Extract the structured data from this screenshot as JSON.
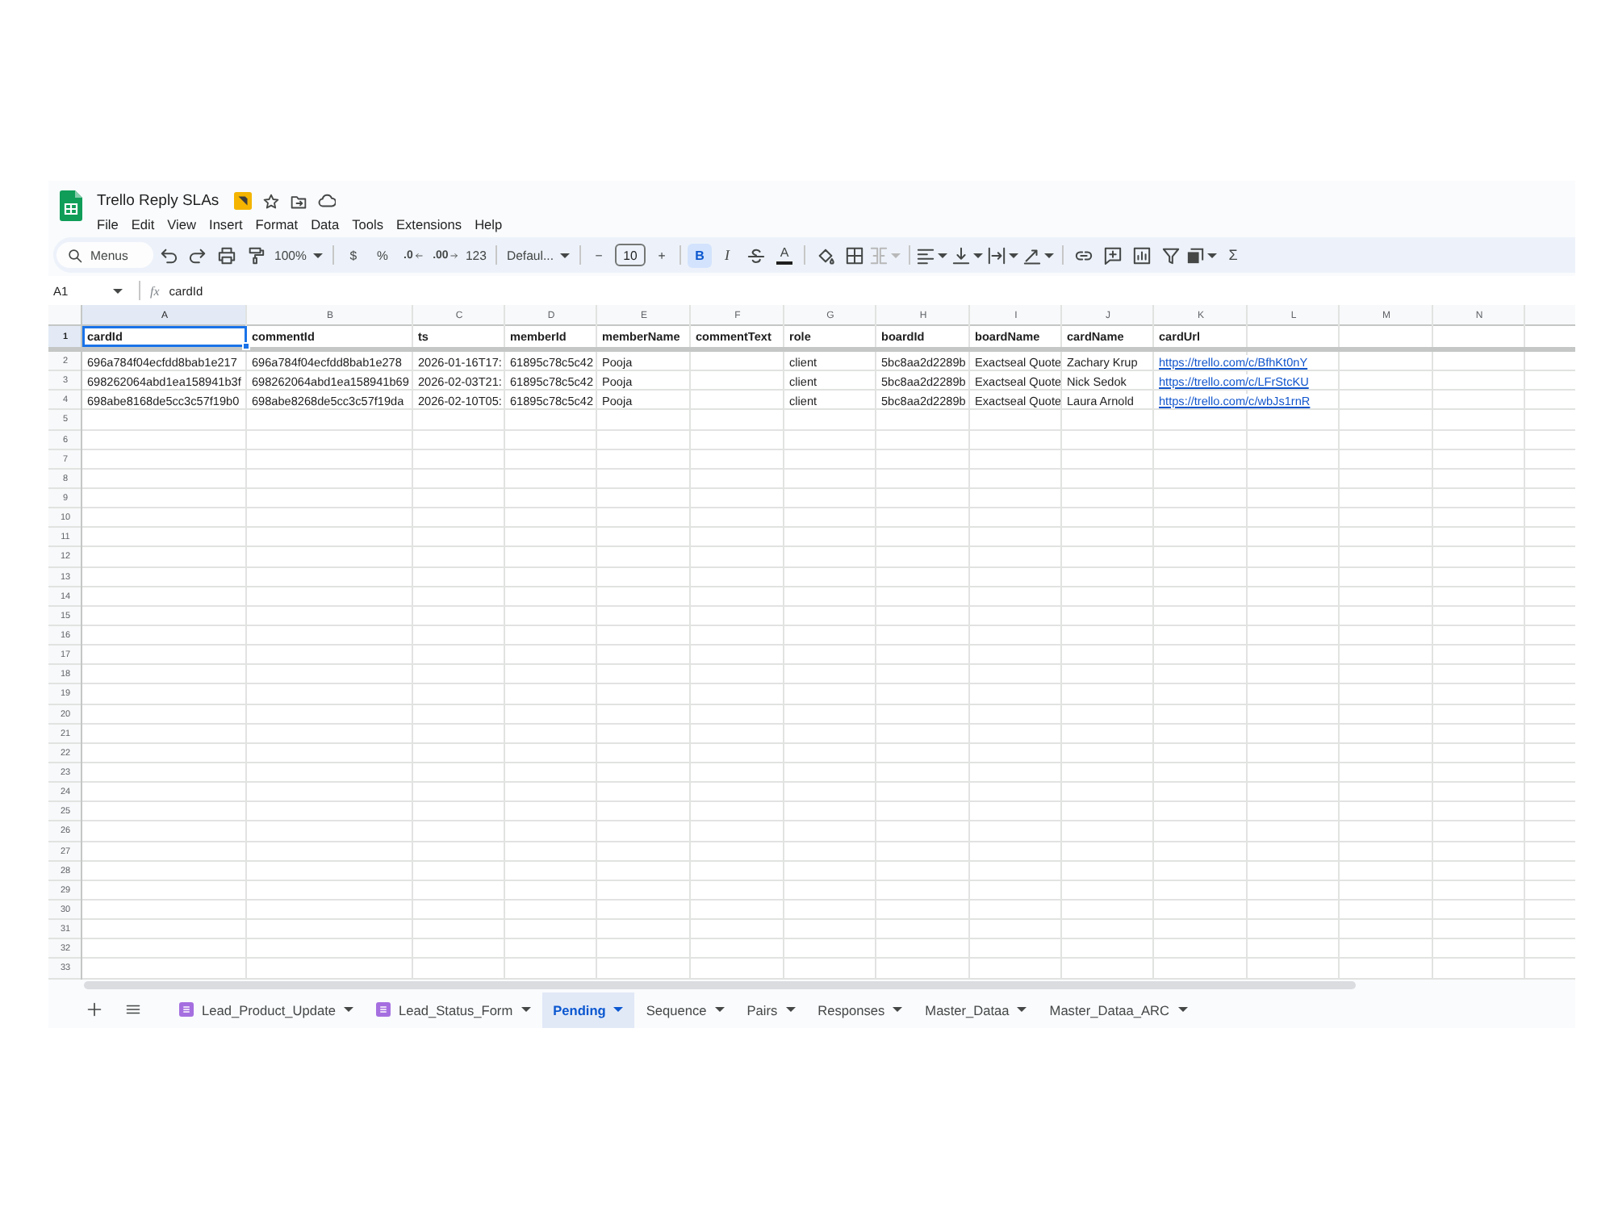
{
  "document": {
    "title": "Trello Reply SLAs"
  },
  "menu": [
    "File",
    "Edit",
    "View",
    "Insert",
    "Format",
    "Data",
    "Tools",
    "Extensions",
    "Help"
  ],
  "toolbar": {
    "search": {
      "placeholder": "Menus"
    },
    "zoom": "100%",
    "currency": "$",
    "percent": "%",
    "decrease_decimal": ".0",
    "increase_decimal": ".00",
    "number_format": "123",
    "font": "Defaul...",
    "font_size_minus": "−",
    "font_size": "10",
    "font_size_plus": "+",
    "bold": {
      "label": "B",
      "on": true
    },
    "italic": {
      "label": "I",
      "on": false
    },
    "text_color": "A",
    "merge": {
      "disabled": true
    },
    "functions": "Σ"
  },
  "formula_bar": {
    "name_box": "A1",
    "fx": "fx",
    "formula": "cardId"
  },
  "grid": {
    "columns": [
      {
        "letter": "A",
        "selected": true
      },
      {
        "letter": "B",
        "selected": false
      },
      {
        "letter": "C",
        "selected": false
      },
      {
        "letter": "D",
        "selected": false
      },
      {
        "letter": "E",
        "selected": false
      },
      {
        "letter": "F",
        "selected": false
      },
      {
        "letter": "G",
        "selected": false
      },
      {
        "letter": "H",
        "selected": false
      },
      {
        "letter": "I",
        "selected": false
      },
      {
        "letter": "J",
        "selected": false
      },
      {
        "letter": "K",
        "selected": false
      },
      {
        "letter": "L",
        "selected": false
      },
      {
        "letter": "M",
        "selected": false
      },
      {
        "letter": "N",
        "selected": false
      }
    ],
    "rows": [
      {
        "number": "1",
        "selected": true,
        "kind": "header",
        "cells": [
          {
            "text": "cardId",
            "kind": "text"
          },
          {
            "text": "commentId",
            "kind": "text"
          },
          {
            "text": "ts",
            "kind": "text"
          },
          {
            "text": "memberId",
            "kind": "text"
          },
          {
            "text": "memberName",
            "kind": "text"
          },
          {
            "text": "commentText",
            "kind": "text"
          },
          {
            "text": "role",
            "kind": "text"
          },
          {
            "text": "boardId",
            "kind": "text"
          },
          {
            "text": "boardName",
            "kind": "text"
          },
          {
            "text": "cardName",
            "kind": "text"
          },
          {
            "text": "cardUrl",
            "kind": "text"
          }
        ]
      },
      {
        "number": "2",
        "selected": false,
        "kind": "data",
        "cells": [
          {
            "text": "696a784f04ecfdd8bab1e217",
            "kind": "text"
          },
          {
            "text": "696a784f04ecfdd8bab1e278",
            "kind": "text"
          },
          {
            "text": "2026-01-16T17:",
            "kind": "text"
          },
          {
            "text": "61895c78c5c42",
            "kind": "text"
          },
          {
            "text": "Pooja",
            "kind": "text"
          },
          null,
          {
            "text": "client",
            "kind": "text"
          },
          {
            "text": "5bc8aa2d2289b",
            "kind": "text"
          },
          {
            "text": "Exactseal Quote",
            "kind": "text"
          },
          {
            "text": "Zachary Krup",
            "kind": "text"
          },
          {
            "text": "https://trello.com/c/BfhKt0nY",
            "kind": "link"
          }
        ]
      },
      {
        "number": "3",
        "selected": false,
        "kind": "data",
        "cells": [
          {
            "text": "698262064abd1ea158941b3f",
            "kind": "text"
          },
          {
            "text": "698262064abd1ea158941b69",
            "kind": "text"
          },
          {
            "text": "2026-02-03T21:",
            "kind": "text"
          },
          {
            "text": "61895c78c5c42",
            "kind": "text"
          },
          {
            "text": "Pooja",
            "kind": "text"
          },
          null,
          {
            "text": "client",
            "kind": "text"
          },
          {
            "text": "5bc8aa2d2289b",
            "kind": "text"
          },
          {
            "text": "Exactseal Quote",
            "kind": "text"
          },
          {
            "text": "Nick Sedok",
            "kind": "text"
          },
          {
            "text": "https://trello.com/c/LFrStcKU",
            "kind": "link"
          }
        ]
      },
      {
        "number": "4",
        "selected": false,
        "kind": "data",
        "cells": [
          {
            "text": "698abe8168de5cc3c57f19b0",
            "kind": "text"
          },
          {
            "text": "698abe8268de5cc3c57f19da",
            "kind": "text"
          },
          {
            "text": "2026-02-10T05:",
            "kind": "text"
          },
          {
            "text": "61895c78c5c42",
            "kind": "text"
          },
          {
            "text": "Pooja",
            "kind": "text"
          },
          null,
          {
            "text": "client",
            "kind": "text"
          },
          {
            "text": "5bc8aa2d2289b",
            "kind": "text"
          },
          {
            "text": "Exactseal Quote",
            "kind": "text"
          },
          {
            "text": "Laura Arnold",
            "kind": "text"
          },
          {
            "text": "https://trello.com/c/wbJs1rnR",
            "kind": "link"
          }
        ]
      },
      {
        "number": "5",
        "selected": false,
        "kind": "data"
      },
      {
        "number": "6",
        "selected": false,
        "kind": "data"
      },
      {
        "number": "7",
        "selected": false,
        "kind": "data"
      },
      {
        "number": "8",
        "selected": false,
        "kind": "data"
      },
      {
        "number": "9",
        "selected": false,
        "kind": "data"
      },
      {
        "number": "10",
        "selected": false,
        "kind": "data"
      },
      {
        "number": "11",
        "selected": false,
        "kind": "data"
      },
      {
        "number": "12",
        "selected": false,
        "kind": "data"
      },
      {
        "number": "13",
        "selected": false,
        "kind": "data"
      },
      {
        "number": "14",
        "selected": false,
        "kind": "data"
      },
      {
        "number": "15",
        "selected": false,
        "kind": "data"
      },
      {
        "number": "16",
        "selected": false,
        "kind": "data"
      },
      {
        "number": "17",
        "selected": false,
        "kind": "data"
      },
      {
        "number": "18",
        "selected": false,
        "kind": "data"
      },
      {
        "number": "19",
        "selected": false,
        "kind": "data"
      },
      {
        "number": "20",
        "selected": false,
        "kind": "data"
      },
      {
        "number": "21",
        "selected": false,
        "kind": "data"
      },
      {
        "number": "22",
        "selected": false,
        "kind": "data"
      },
      {
        "number": "23",
        "selected": false,
        "kind": "data"
      },
      {
        "number": "24",
        "selected": false,
        "kind": "data"
      },
      {
        "number": "25",
        "selected": false,
        "kind": "data"
      },
      {
        "number": "26",
        "selected": false,
        "kind": "data"
      },
      {
        "number": "27",
        "selected": false,
        "kind": "data"
      },
      {
        "number": "28",
        "selected": false,
        "kind": "data"
      },
      {
        "number": "29",
        "selected": false,
        "kind": "data"
      },
      {
        "number": "30",
        "selected": false,
        "kind": "data"
      },
      {
        "number": "31",
        "selected": false,
        "kind": "data"
      },
      {
        "number": "32",
        "selected": false,
        "kind": "data"
      },
      {
        "number": "33",
        "selected": false,
        "kind": "data"
      }
    ]
  },
  "sheet_tabs": [
    {
      "label": "Lead_Product_Update",
      "kind": "form",
      "selected": false
    },
    {
      "label": "Lead_Status_Form",
      "kind": "form",
      "selected": false
    },
    {
      "label": "Pending",
      "kind": "sheet",
      "selected": true
    },
    {
      "label": "Sequence",
      "kind": "sheet",
      "selected": false
    },
    {
      "label": "Pairs",
      "kind": "sheet",
      "selected": false
    },
    {
      "label": "Responses",
      "kind": "sheet",
      "selected": false
    },
    {
      "label": "Master_Dataa",
      "kind": "sheet",
      "selected": false
    },
    {
      "label": "Master_Dataa_ARC",
      "kind": "sheet",
      "selected": false
    }
  ]
}
